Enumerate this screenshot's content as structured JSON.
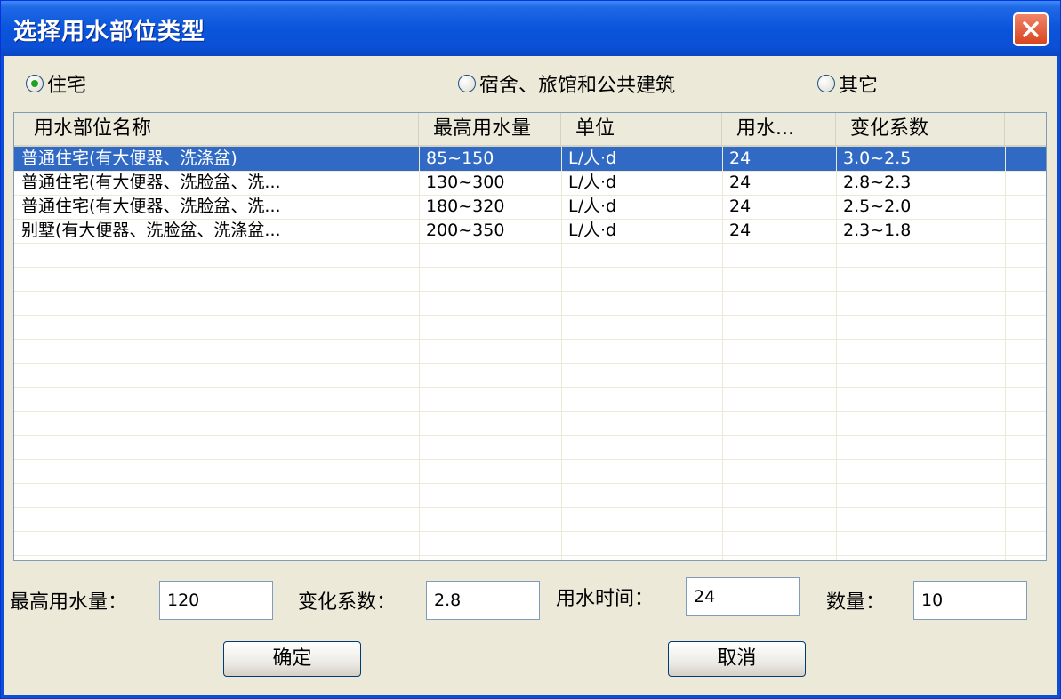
{
  "window": {
    "title": "选择用水部位类型"
  },
  "radios": [
    {
      "label": "住宅",
      "checked": true
    },
    {
      "label": "宿舍、旅馆和公共建筑",
      "checked": false
    },
    {
      "label": "其它",
      "checked": false
    }
  ],
  "table": {
    "columns": [
      "用水部位名称",
      "最高用水量",
      "单位",
      "用水...",
      "变化系数"
    ],
    "rows": [
      [
        "普通住宅(有大便器、洗涤盆)",
        "85~150",
        "L/人·d",
        "24",
        "3.0~2.5"
      ],
      [
        "普通住宅(有大便器、洗脸盆、洗...",
        "130~300",
        "L/人·d",
        "24",
        "2.8~2.3"
      ],
      [
        "普通住宅(有大便器、洗脸盆、洗...",
        "180~320",
        "L/人·d",
        "24",
        "2.5~2.0"
      ],
      [
        "别墅(有大便器、洗脸盆、洗涤盆...",
        "200~350",
        "L/人·d",
        "24",
        "2.3~1.8"
      ]
    ],
    "selected_row": 0
  },
  "fields": {
    "max_water_label": "最高用水量：",
    "max_water_value": "120",
    "coef_label": "变化系数：",
    "coef_value": "2.8",
    "time_label": "用水时间：",
    "time_value": "24",
    "count_label": "数量：",
    "count_value": "10"
  },
  "buttons": {
    "ok": "确定",
    "cancel": "取消"
  },
  "colors": {
    "title_bar": "#0b4fd4",
    "selection": "#316ac5",
    "face": "#ece9d8"
  }
}
